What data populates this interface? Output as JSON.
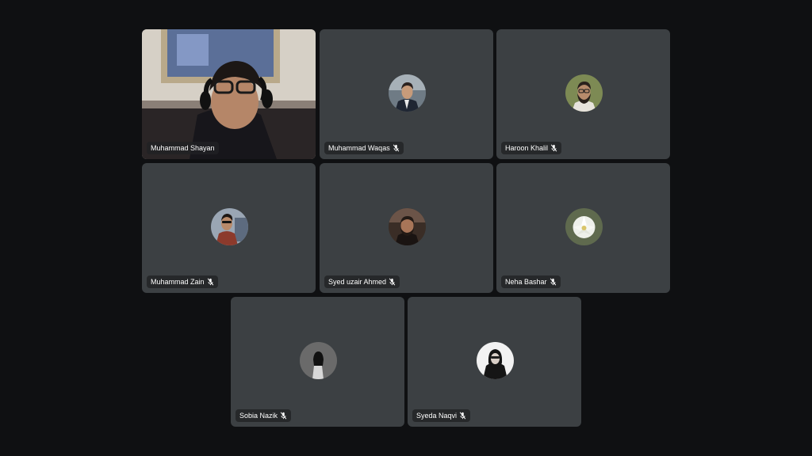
{
  "participants": [
    {
      "name": "Muhammad Shayan",
      "muted": false,
      "video": true
    },
    {
      "name": "Muhammad Waqas",
      "muted": true,
      "video": false
    },
    {
      "name": "Haroon Khalil",
      "muted": true,
      "video": false
    },
    {
      "name": "Muhammad Zain",
      "muted": true,
      "video": false
    },
    {
      "name": "Syed uzair Ahmed",
      "muted": true,
      "video": false
    },
    {
      "name": "Neha Bashar",
      "muted": true,
      "video": false
    },
    {
      "name": "Sobia Nazik",
      "muted": true,
      "video": false
    },
    {
      "name": "Syeda Naqvi",
      "muted": true,
      "video": false
    }
  ],
  "colors": {
    "background": "#0f1012",
    "tile": "#3c4043",
    "chip": "#202124"
  },
  "icons": {
    "muted": "mic-off-icon"
  }
}
